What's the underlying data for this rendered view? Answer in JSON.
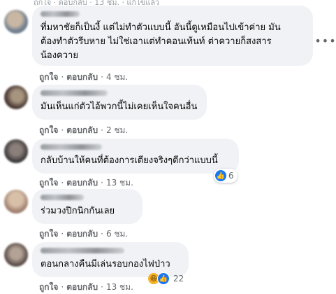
{
  "top_partial": {
    "text": "ถูกใจ · ตอบกลับ · 13 ชม. · แก้ไขแล้ว"
  },
  "comments": [
    {
      "text": "ที่มหาชัยก็เป็นงี้ แต่ไม่ทำตัวแบบนี้ อันนี้ดูเหมือนไปเข้าค่าย มัน\nต้องทำตัวรีบหาย ไม่ใช่เอาแต่ทำคอนเท้นท์ ต่าควายก็สงสาร\nน้องควาย",
      "like": "ถูกใจ",
      "reply": "ตอบกลับ",
      "time": "4 ชม.",
      "avatar_colors": [
        "#6f7f8f",
        "#c9b7a4"
      ]
    },
    {
      "text": "มันเห็นแก่ตัวไอ้พวกนี้ไม่เคยเห็นใจคนอื่น",
      "like": "ถูกใจ",
      "reply": "ตอบกลับ",
      "time": "2 ชม.",
      "avatar_colors": [
        "#4b3a35",
        "#a6947f"
      ]
    },
    {
      "text": "กลับบ้านให้คนที่ต้องการเตียงจริงๆดีกว่าแบบนี้",
      "like": "ถูกใจ",
      "reply": "ตอบกลับ",
      "time": "13 ชม.",
      "reaction_count": "6",
      "avatar_colors": [
        "#3d3a3a",
        "#8b7f7a"
      ]
    },
    {
      "text": "ร่วมวงปิกนิกกันเลย",
      "like": "ถูกใจ",
      "reply": "ตอบกลับ",
      "time": "6 ชม.",
      "avatar_colors": [
        "#a08070",
        "#d8c0a8"
      ]
    },
    {
      "text": "ตอนกลางคืนมีเล่นรอบกองไฟป่าว",
      "like": "ถูกใจ",
      "reply": "ตอบกลับ",
      "time": "13 ชม.",
      "reaction_count": "22",
      "avatar_colors": [
        "#5a4d48",
        "#b3a296"
      ]
    }
  ],
  "colors": {
    "bubble": "#f0f2f5",
    "meta": "#65676b",
    "like_blue": "#1877f2",
    "haha_yellow": "#f7b125"
  },
  "icons": {
    "more": "more-horizontal-icon",
    "like": "like-reaction-icon",
    "haha": "haha-reaction-icon"
  }
}
